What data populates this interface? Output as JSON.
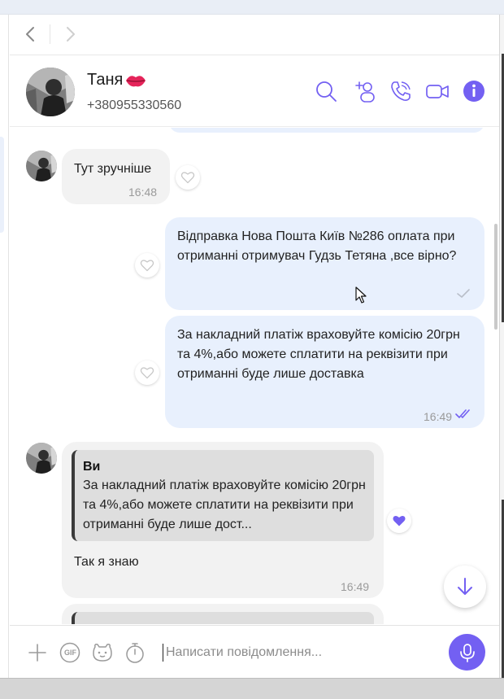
{
  "contact": {
    "name": "Таня",
    "phone": "+380955330560"
  },
  "colors": {
    "accent": "#7360f2",
    "incoming_bubble": "#f2f2f2",
    "outgoing_bubble": "#e8f0fd",
    "quote_bar": "#3a3a3a"
  },
  "header_icons": [
    "search-icon",
    "add-participant-icon",
    "call-icon",
    "video-call-icon",
    "info-icon"
  ],
  "messages": [
    {
      "direction": "in",
      "text": "Тут зручніше",
      "time": "16:48",
      "reaction": "heart-outline"
    },
    {
      "direction": "out",
      "text": "Відправка  Нова Пошта Київ №286 оплата при отриманні отримувач Гудзь Тетяна ,все вірно?",
      "time": "",
      "status": "sent-check",
      "reaction": "heart-outline"
    },
    {
      "direction": "out",
      "text": "За накладний платіж враховуйте комісію 20грн та 4%,або можете сплатити на реквізити при отриманні буде лише доставка",
      "time": "16:49",
      "status": "read-double-check",
      "reaction": "heart-outline"
    },
    {
      "direction": "in",
      "quote_author": "Ви",
      "quote_text": "За накладний платіж враховуйте комісію 20грн та 4%,або можете сплатити на реквізити при отриманні буде лише дост...",
      "text": "Так я знаю",
      "time": "16:49",
      "reaction": "heart-filled"
    }
  ],
  "composer": {
    "placeholder": "Написати повідомлення...",
    "gif_label": "GIF",
    "icons": [
      "plus-icon",
      "gif-icon",
      "sticker-icon",
      "timer-icon",
      "microphone-icon"
    ]
  }
}
